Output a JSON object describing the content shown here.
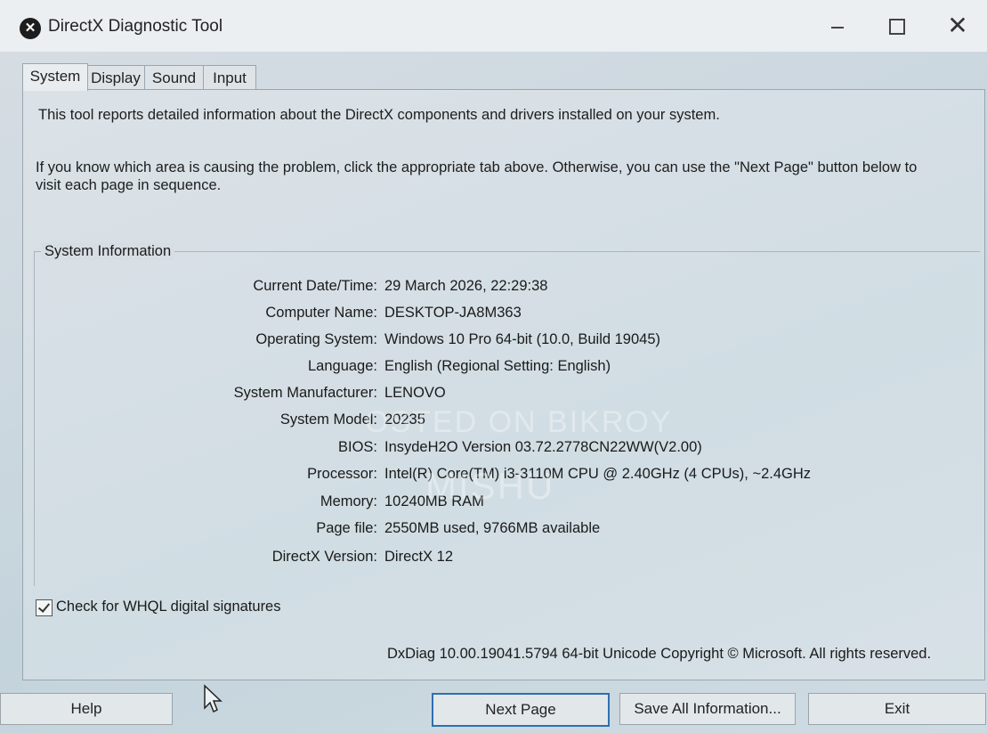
{
  "window": {
    "title": "DirectX Diagnostic Tool",
    "close_glyph": "✕"
  },
  "tabs": [
    {
      "label": "System"
    },
    {
      "label": "Display"
    },
    {
      "label": "Sound"
    },
    {
      "label": "Input"
    }
  ],
  "intro": {
    "line1": "This tool reports detailed information about the DirectX components and drivers installed on your system.",
    "line2a": "If you know which area is causing the problem, click the appropriate tab above. Otherwise, you can use the \"Next Page\" button below to",
    "line2b": "visit each page in sequence."
  },
  "system_info": {
    "title": "System Information",
    "rows": [
      {
        "label": "Current Date/Time:",
        "value": "29 March 2026, 22:29:38"
      },
      {
        "label": "Computer Name:",
        "value": "DESKTOP-JA8M363"
      },
      {
        "label": "Operating System:",
        "value": "Windows 10 Pro 64-bit (10.0, Build 19045)"
      },
      {
        "label": "Language:",
        "value": "English (Regional Setting: English)"
      },
      {
        "label": "System Manufacturer:",
        "value": "LENOVO"
      },
      {
        "label": "System Model:",
        "value": "20235"
      },
      {
        "label": "BIOS:",
        "value": "InsydeH2O Version 03.72.2778CN22WW(V2.00)"
      },
      {
        "label": "Processor:",
        "value": "Intel(R) Core(TM) i3-3110M CPU @ 2.40GHz (4 CPUs), ~2.4GHz"
      },
      {
        "label": "Memory:",
        "value": "10240MB RAM"
      },
      {
        "label": "Page file:",
        "value": "2550MB used, 9766MB available"
      },
      {
        "label": "DirectX Version:",
        "value": "DirectX 12"
      }
    ]
  },
  "whql": {
    "label": "Check for WHQL digital signatures",
    "checked": true
  },
  "copyright": "DxDiag 10.00.19041.5794 64-bit Unicode  Copyright © Microsoft. All rights reserved.",
  "buttons": {
    "help": "Help",
    "next_page": "Next Page",
    "save_all": "Save All Information...",
    "exit": "Exit"
  },
  "watermark": {
    "line1": "OSTED ON BIKROY",
    "line2": "MISHU"
  }
}
